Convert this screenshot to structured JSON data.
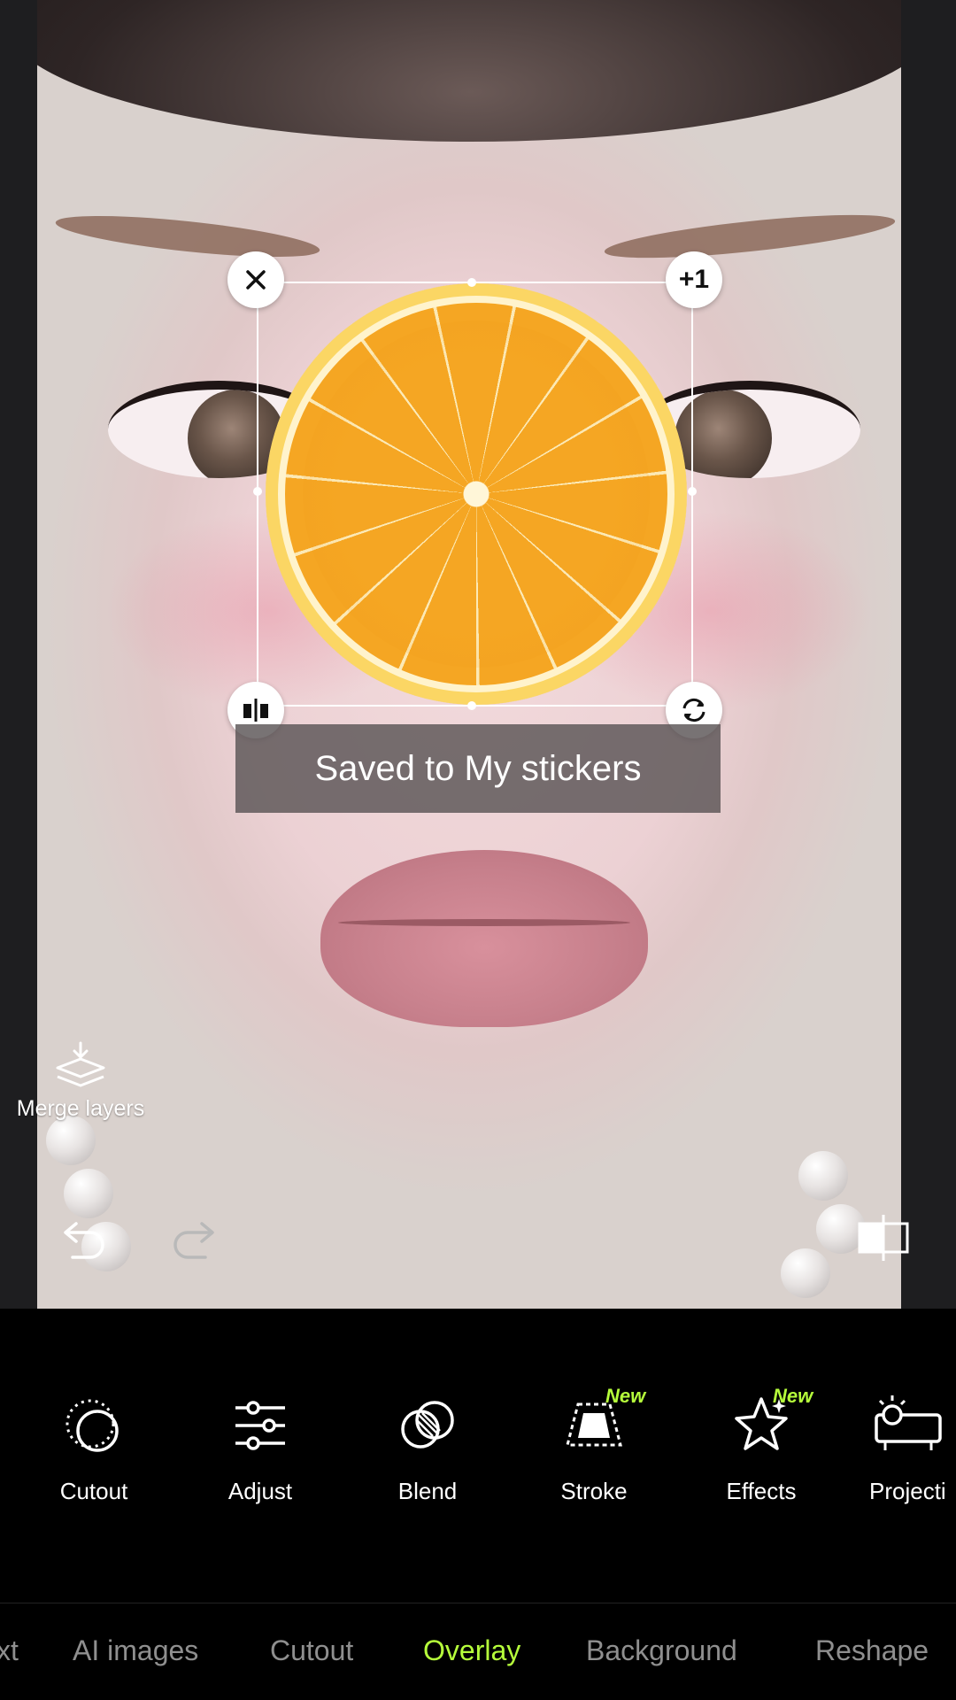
{
  "toast": {
    "text": "Saved to My stickers"
  },
  "sticker": {
    "badge": "+1"
  },
  "merge_layers": {
    "label": "Merge layers"
  },
  "tools": [
    {
      "label": "Cutout",
      "icon": "cutout-icon",
      "badge": ""
    },
    {
      "label": "Adjust",
      "icon": "sliders-icon",
      "badge": ""
    },
    {
      "label": "Blend",
      "icon": "blend-icon",
      "badge": ""
    },
    {
      "label": "Stroke",
      "icon": "stroke-icon",
      "badge": "New"
    },
    {
      "label": "Effects",
      "icon": "star-effects-icon",
      "badge": "New"
    },
    {
      "label": "Projecti",
      "icon": "projector-icon",
      "badge": ""
    }
  ],
  "tabs": {
    "t0": "xt",
    "t1": "AI images",
    "t2": "Cutout",
    "t3": "Overlay",
    "t4": "Background",
    "t5": "Reshape"
  },
  "colors": {
    "accent": "#b6ff3b",
    "toolbar_bg": "#000000"
  }
}
